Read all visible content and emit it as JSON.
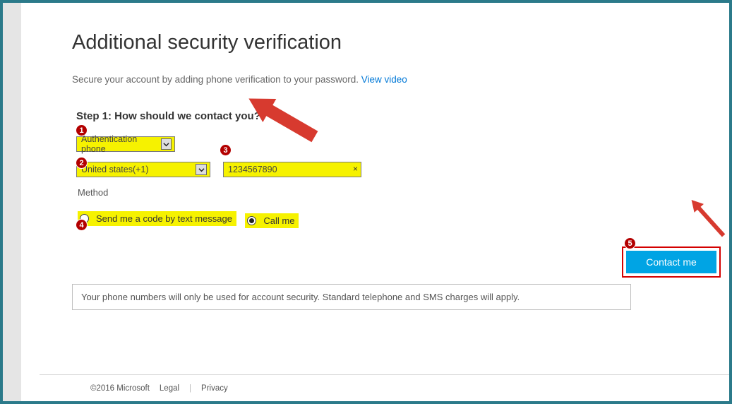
{
  "title": "Additional security verification",
  "intro_text": "Secure your account by adding phone verification to your password. ",
  "intro_link": "View video",
  "step_title": "Step 1: How should we contact you?",
  "contact_method_select": "Authentication phone",
  "country_select": "United states(+1)",
  "phone_value": "1234567890",
  "method_label": "Method",
  "method_options": {
    "sms": "Send me a code by text message",
    "call": "Call me"
  },
  "footnote": "Your phone numbers will only be used for account security. Standard telephone and SMS charges will apply.",
  "contact_button": "Contact me",
  "footer": {
    "copyright": "©2016 Microsoft",
    "legal": "Legal",
    "privacy": "Privacy"
  },
  "annotations": {
    "n1": "1",
    "n2": "2",
    "n3": "3",
    "n4": "4",
    "n5": "5"
  }
}
